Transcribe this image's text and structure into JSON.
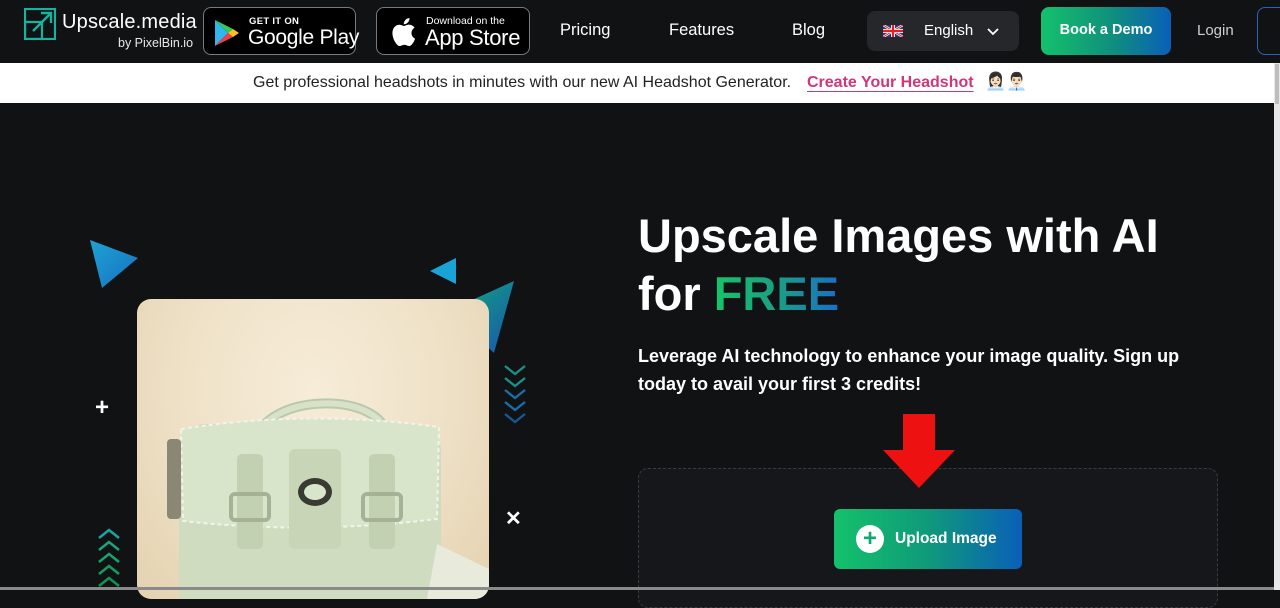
{
  "nav": {
    "brand_name": "Upscale.media",
    "brand_sub": "by PixelBin.io",
    "google_play": {
      "small": "GET IT ON",
      "big": "Google Play"
    },
    "app_store": {
      "small": "Download on the",
      "big": "App Store"
    },
    "links": [
      "Pricing",
      "Features",
      "Blog"
    ],
    "language": "English",
    "book_demo": "Book a Demo",
    "login": "Login"
  },
  "banner": {
    "text": "Get professional headshots in minutes with our new AI Headshot Generator.",
    "link": "Create Your Headshot",
    "emoji": "👩🏻‍💼👨🏻‍💼"
  },
  "hero": {
    "title_line1": "Upscale Images with AI",
    "title_for": "for ",
    "title_free": "FREE",
    "subtitle": "Leverage AI technology to enhance your image quality. Sign up today to avail your first 3 credits!",
    "upload_label": "Upload Image",
    "upload_icon": "+"
  },
  "colors": {
    "accent_green": "#14c16b",
    "accent_blue": "#0a5fb8",
    "link_pink": "#d1357a",
    "arrow_red": "#ee1111",
    "background": "#111214"
  },
  "icons": [
    "upscale-logo-icon",
    "google-play-icon",
    "apple-icon",
    "uk-flag-icon",
    "chevron-down-icon",
    "plus-icon",
    "red-arrow-down-icon"
  ]
}
